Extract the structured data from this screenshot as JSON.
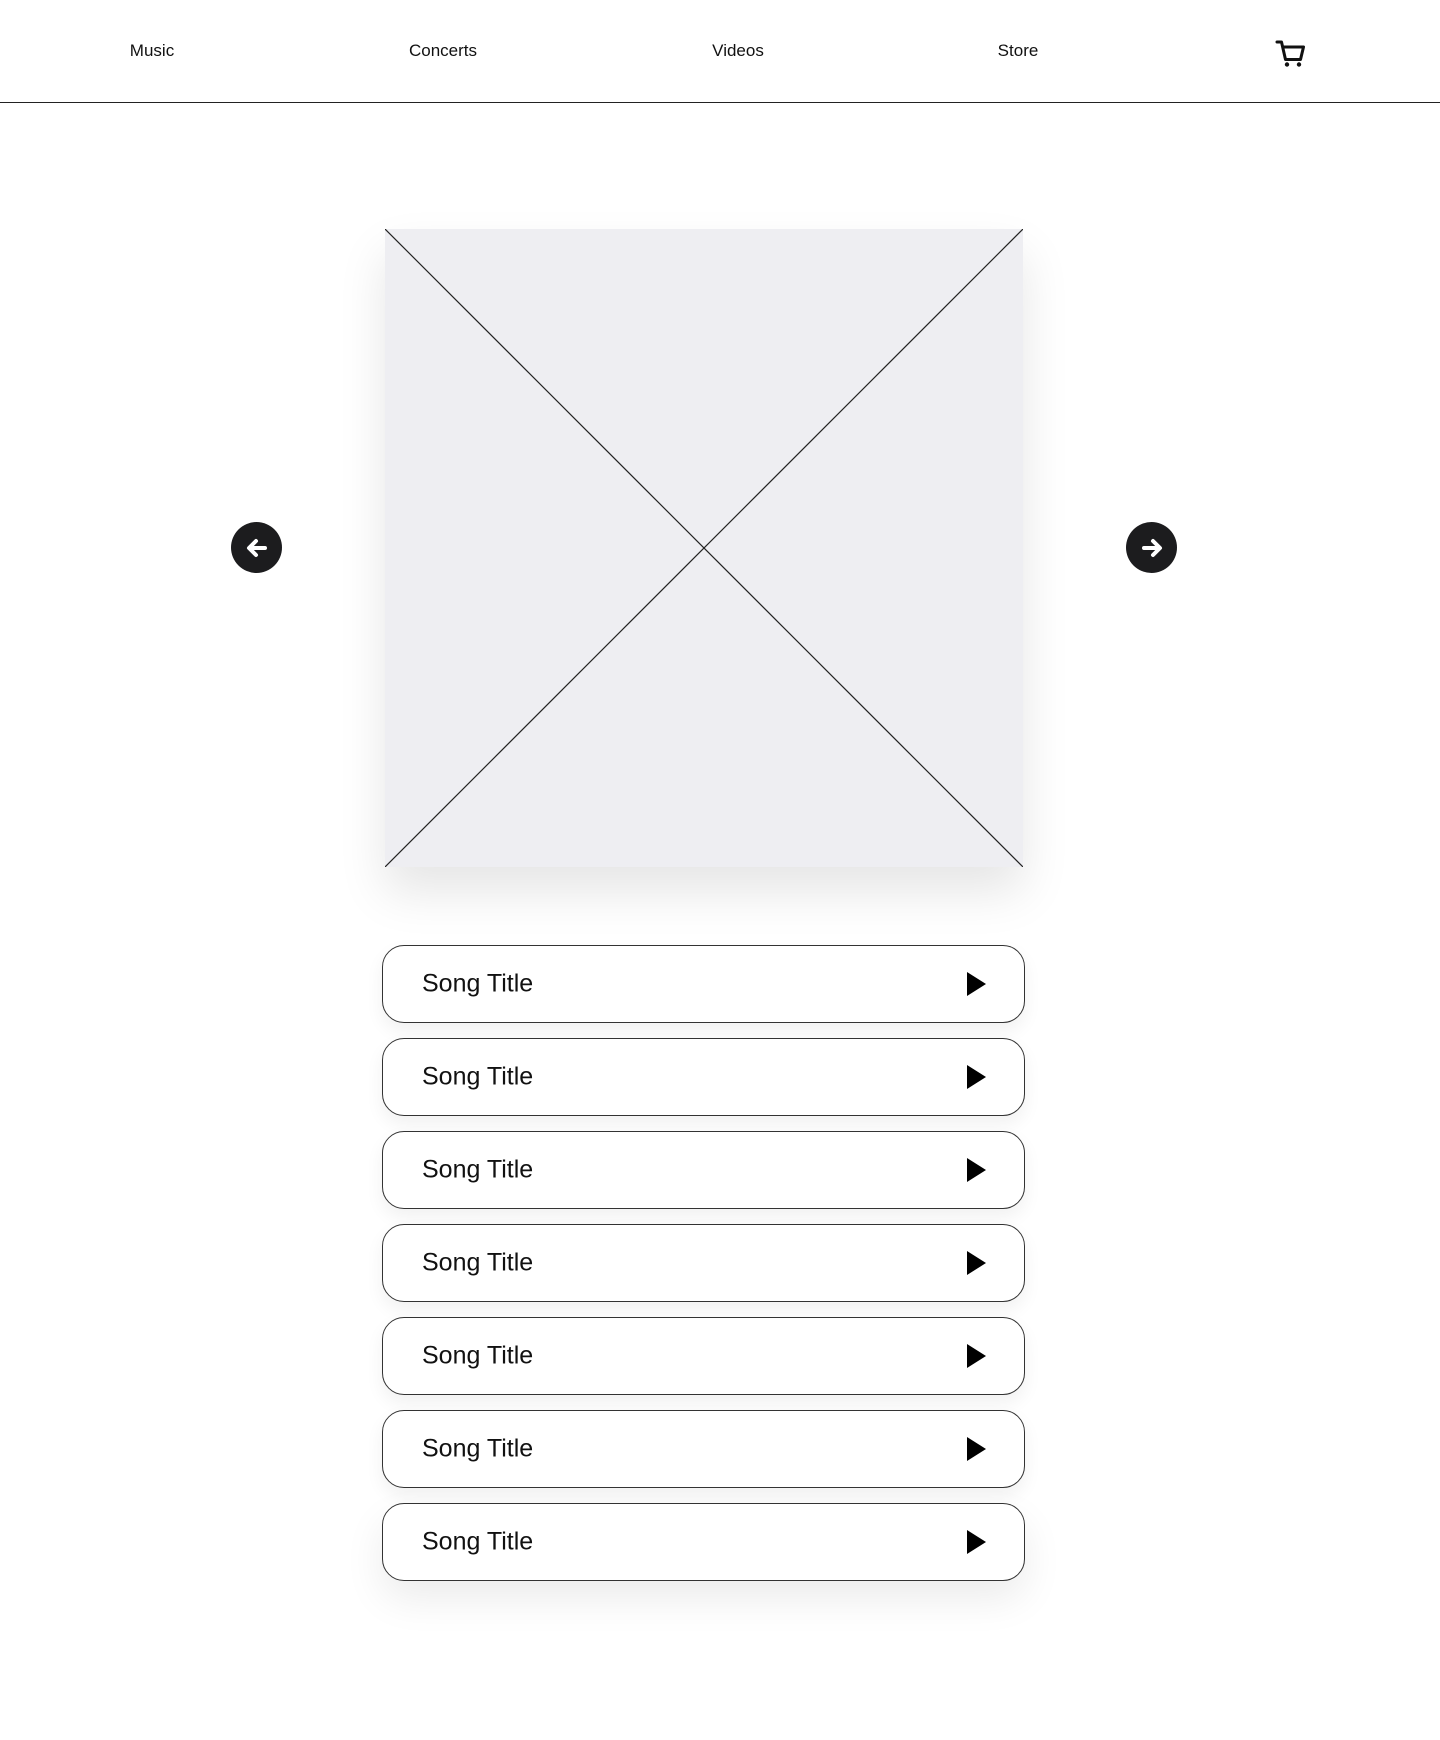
{
  "nav": {
    "links": [
      {
        "label": "Music"
      },
      {
        "label": "Concerts"
      },
      {
        "label": "Videos"
      },
      {
        "label": "Store"
      }
    ],
    "cart_icon": "shopping-cart-icon"
  },
  "hero": {
    "image_placeholder": "image-placeholder",
    "prev_icon": "arrow-left-icon",
    "next_icon": "arrow-right-icon"
  },
  "songs": [
    {
      "title": "Song Title",
      "action_icon": "play-icon"
    },
    {
      "title": "Song Title",
      "action_icon": "play-icon"
    },
    {
      "title": "Song Title",
      "action_icon": "play-icon"
    },
    {
      "title": "Song Title",
      "action_icon": "play-icon"
    },
    {
      "title": "Song Title",
      "action_icon": "play-icon"
    },
    {
      "title": "Song Title",
      "action_icon": "play-icon"
    },
    {
      "title": "Song Title",
      "action_icon": "play-icon"
    }
  ],
  "colors": {
    "background": "#ffffff",
    "text": "#111111",
    "placeholder_fill": "#eeeef2",
    "arrow_fill": "#1c1c1e",
    "border": "#333333"
  }
}
